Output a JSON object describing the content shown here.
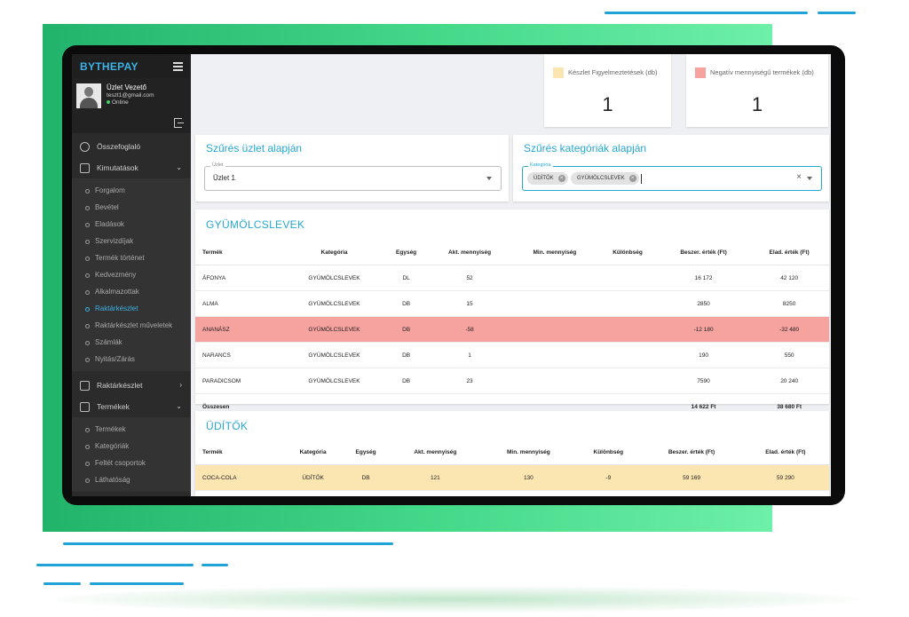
{
  "colors": {
    "brand": "#3bb3e6",
    "accent": "#27a7d3",
    "warning_swatch": "#fbe6b2",
    "negative_swatch": "#f6a29e",
    "sidebar_bg": "#2b2b2b",
    "green_gradient_start": "#22b36b",
    "green_gradient_end": "#6ef0a8"
  },
  "sidebar": {
    "brand": "BYTHEPAY",
    "user": {
      "name": "Üzlet Vezető",
      "email": "teszt1@gmail.com",
      "status": "Online"
    },
    "top_items": [
      {
        "label": "Összefoglaló",
        "icon": "dashboard-icon"
      },
      {
        "label": "Kimutatások",
        "icon": "chart-icon",
        "expanded": true
      }
    ],
    "reports_sub": [
      "Forgalom",
      "Bevétel",
      "Eladások",
      "Szervizdíjak",
      "Termék történet",
      "Kedvezmény",
      "Alkalmazottak",
      "Raktárkészlet",
      "Raktárkészlet műveletek",
      "Számlák",
      "Nyitás/Zárás"
    ],
    "active_sub": "Raktárkészlet",
    "stock_item": {
      "label": "Raktárkészlet",
      "icon": "grid-icon"
    },
    "products_item": {
      "label": "Termékek",
      "icon": "box-icon",
      "expanded": true
    },
    "products_sub": [
      "Termékek",
      "Kategóriák",
      "Feltét csoportok",
      "Láthatóság"
    ]
  },
  "kpis": [
    {
      "label": "Készlet Figyelmeztetések (db)",
      "value": "1"
    },
    {
      "label": "Negatív mennyiségű termékek (db)",
      "value": "1"
    }
  ],
  "filters": {
    "store": {
      "title": "Szűrés üzlet alapján",
      "field_label": "Üzlet",
      "value": "Üzlet 1"
    },
    "category": {
      "title": "Szűrés kategóriák alapján",
      "field_label": "Kategória",
      "chips": [
        "ÜDÍTŐK",
        "GYÜMÖLCSLEVEK"
      ]
    }
  },
  "headers": [
    "Termék",
    "Kategória",
    "Egység",
    "Akt. mennyiség",
    "Min. mennyiség",
    "Különbség",
    "Beszer. érték (Ft)",
    "Elad. érték (Ft)"
  ],
  "tables": [
    {
      "title": "GYÜMÖLCSLEVEK",
      "rows": [
        {
          "product": "ÁFONYA",
          "category": "GYÜMÖLCSLEVEK",
          "unit": "DL",
          "current": "52",
          "min": "",
          "diff": "",
          "purchase": "16 172",
          "sale": "42 120",
          "state": "normal"
        },
        {
          "product": "ALMA",
          "category": "GYÜMÖLCSLEVEK",
          "unit": "DB",
          "current": "15",
          "min": "",
          "diff": "",
          "purchase": "2850",
          "sale": "8250",
          "state": "normal"
        },
        {
          "product": "ANANÁSZ",
          "category": "GYÜMÖLCSLEVEK",
          "unit": "DB",
          "current": "-58",
          "min": "",
          "diff": "",
          "purchase": "-12 180",
          "sale": "-32 480",
          "state": "negative"
        },
        {
          "product": "NARANCS",
          "category": "GYÜMÖLCSLEVEK",
          "unit": "DB",
          "current": "1",
          "min": "",
          "diff": "",
          "purchase": "190",
          "sale": "550",
          "state": "normal"
        },
        {
          "product": "PARADICSOM",
          "category": "GYÜMÖLCSLEVEK",
          "unit": "DB",
          "current": "23",
          "min": "",
          "diff": "",
          "purchase": "7590",
          "sale": "20 240",
          "state": "normal"
        }
      ],
      "total": {
        "label": "Összesen",
        "purchase": "14 622 Ft",
        "sale": "38 680 Ft"
      }
    },
    {
      "title": "ÜDÍTŐK",
      "rows": [
        {
          "product": "COCA-COLA",
          "category": "ÜDÍTŐK",
          "unit": "DB",
          "current": "121",
          "min": "130",
          "diff": "-9",
          "purchase": "59 169",
          "sale": "59 290",
          "state": "warning"
        }
      ]
    }
  ]
}
